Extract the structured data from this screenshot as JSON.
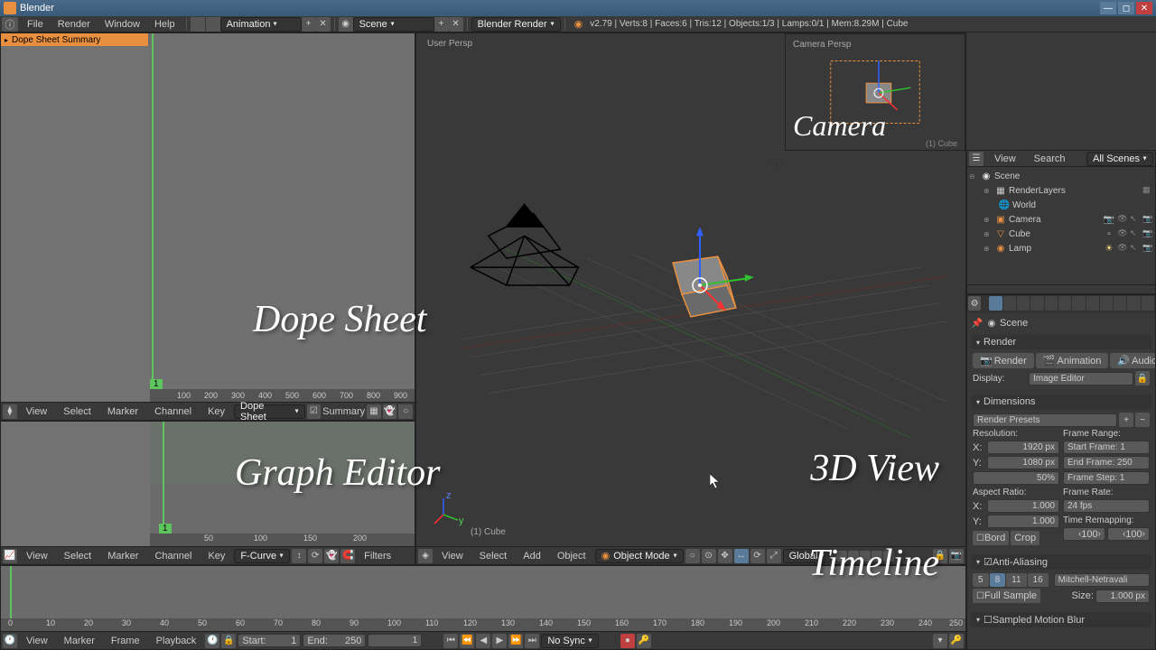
{
  "app": {
    "title": "Blender"
  },
  "menubar": {
    "items": [
      "File",
      "Render",
      "Window",
      "Help"
    ],
    "layout": "Animation",
    "scene": "Scene",
    "renderer": "Blender Render",
    "stats": "v2.79 | Verts:8 | Faces:6 | Tris:12 | Objects:1/3 | Lamps:0/1 | Mem:8.29M | Cube"
  },
  "dopesheet": {
    "summary": "Dope Sheet Summary",
    "frame": "1",
    "ticks": [
      "100",
      "200",
      "300",
      "400",
      "500",
      "600",
      "700",
      "800",
      "900"
    ],
    "footer_menus": [
      "View",
      "Select",
      "Marker",
      "Channel",
      "Key"
    ],
    "mode": "Dope Sheet",
    "summary_btn": "Summary"
  },
  "grapheditor": {
    "frame": "1",
    "ticks": [
      "50",
      "100",
      "150",
      "200"
    ],
    "footer_menus": [
      "View",
      "Select",
      "Marker",
      "Channel",
      "Key"
    ],
    "mode": "F-Curve",
    "filters": "Filters"
  },
  "viewport": {
    "persp": "User Persp",
    "object": "(1) Cube",
    "footer_menus": [
      "View",
      "Select",
      "Add",
      "Object"
    ],
    "mode": "Object Mode",
    "orientation": "Global"
  },
  "camera_preview": {
    "label": "Camera Persp",
    "object": "(1) Cube",
    "big": "Camera"
  },
  "outliner": {
    "menus": [
      "View",
      "Search"
    ],
    "filter": "All Scenes",
    "tree": {
      "scene": "Scene",
      "renderlayers": "RenderLayers",
      "world": "World",
      "camera": "Camera",
      "cube": "Cube",
      "lamp": "Lamp"
    }
  },
  "properties": {
    "breadcrumb": "Scene",
    "render_panel": "Render",
    "render_btn": "Render",
    "animation_btn": "Animation",
    "audio_btn": "Audio",
    "display_label": "Display:",
    "display_val": "Image Editor",
    "dimensions_panel": "Dimensions",
    "render_presets": "Render Presets",
    "resolution_label": "Resolution:",
    "res_x": "1920 px",
    "res_y": "1080 px",
    "res_pct": "50%",
    "frame_range_label": "Frame Range:",
    "start_frame": "Start Frame: 1",
    "end_frame": "End Frame: 250",
    "frame_step": "Frame Step: 1",
    "aspect_label": "Aspect Ratio:",
    "aspect_x": "1.000",
    "aspect_y": "1.000",
    "framerate_label": "Frame Rate:",
    "fps": "24 fps",
    "time_remap": "Time Remapping:",
    "remap_old": "100",
    "remap_new": "100",
    "border": "Bord",
    "crop": "Crop",
    "aa_panel": "Anti-Aliasing",
    "aa_samples": [
      "5",
      "8",
      "11",
      "16"
    ],
    "aa_filter": "Mitchell-Netravali",
    "full_sample": "Full Sample",
    "size_label": "Size:",
    "size_val": "1.000 px",
    "motion_blur": "Sampled Motion Blur"
  },
  "timeline": {
    "ticks": [
      "0",
      "10",
      "20",
      "30",
      "40",
      "50",
      "60",
      "70",
      "80",
      "90",
      "100",
      "110",
      "120",
      "130",
      "140",
      "150",
      "160",
      "170",
      "180",
      "190",
      "200",
      "210",
      "220",
      "230",
      "240",
      "250"
    ],
    "footer_menus": [
      "View",
      "Marker",
      "Frame",
      "Playback"
    ],
    "start_label": "Start:",
    "start_val": "1",
    "end_label": "End:",
    "end_val": "250",
    "current": "1",
    "sync": "No Sync"
  },
  "overlays": {
    "dope": "Dope Sheet",
    "graph": "Graph Editor",
    "view3d": "3D View",
    "timeline": "Timeline"
  }
}
